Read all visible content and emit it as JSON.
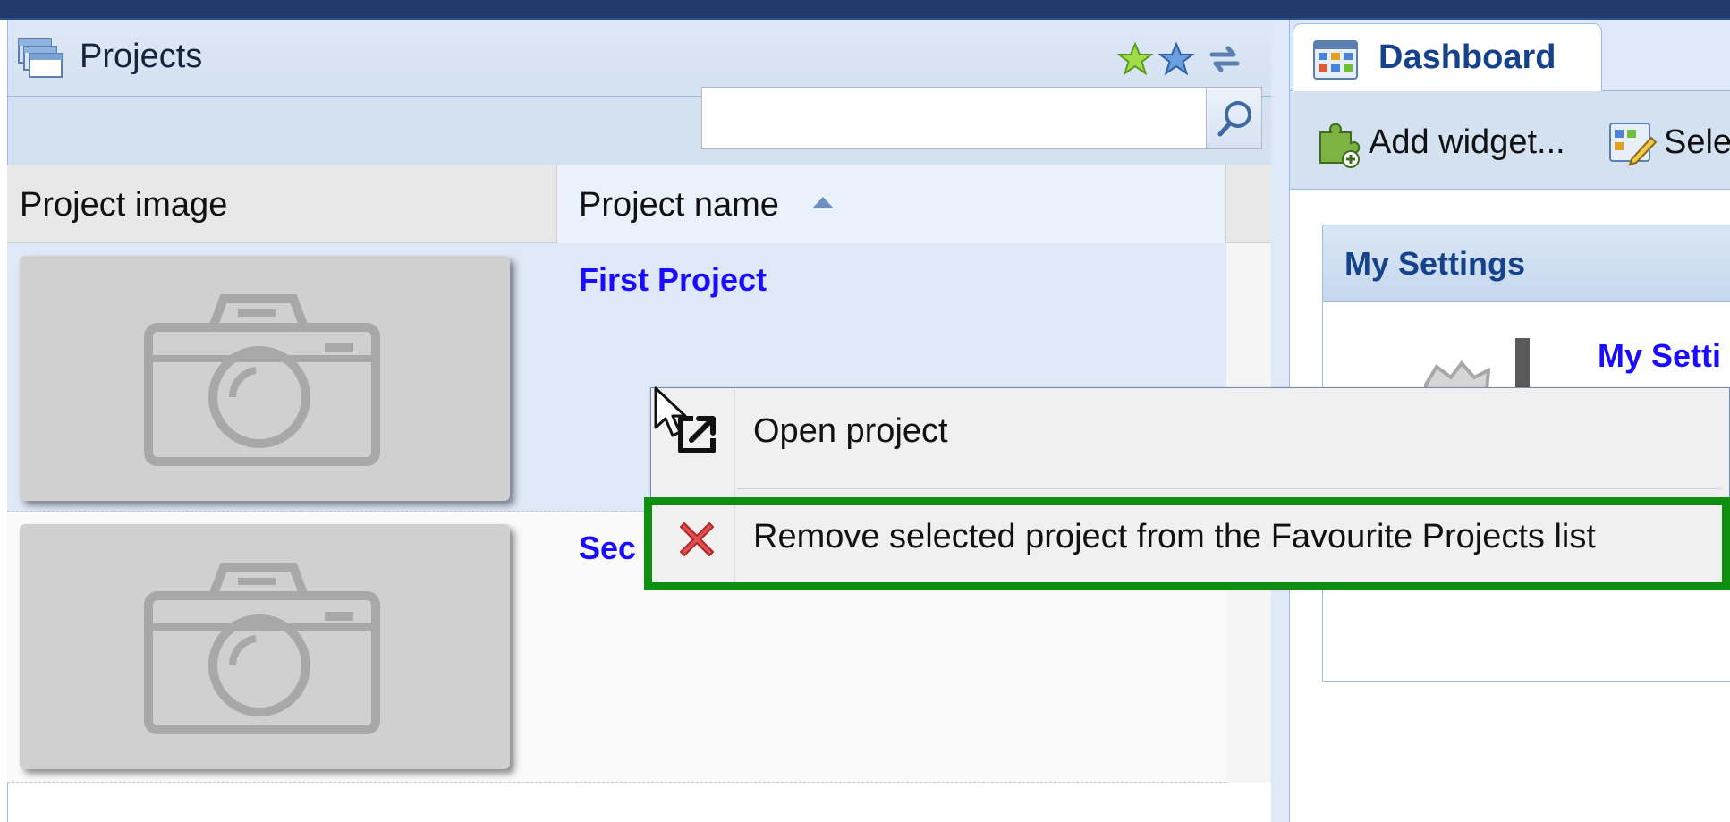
{
  "colors": {
    "topbar": "#1f3a6b",
    "panel_header": "#dfe8f6",
    "link_blue": "#1a0dff",
    "tab_title": "#15428b",
    "highlight_green": "#0f8f0f",
    "remove_red": "#e03a3a"
  },
  "projects_panel": {
    "title": "Projects",
    "title_icon": "projects-stack-icon",
    "tools": [
      {
        "name": "favourite-add-icon",
        "color": "#7fcf2a"
      },
      {
        "name": "favourite-star-icon",
        "color": "#4a84d6"
      },
      {
        "name": "refresh-icon",
        "color": "#5a7fb0"
      }
    ],
    "search": {
      "value": "",
      "placeholder": "",
      "button_icon": "search-icon"
    },
    "columns": {
      "image": "Project image",
      "name": "Project name",
      "sort": "ascending"
    },
    "rows": [
      {
        "name": "First Project",
        "image_icon": "camera-placeholder-icon",
        "selected": true
      },
      {
        "name": "Sec",
        "image_icon": "camera-placeholder-icon",
        "selected": false
      }
    ]
  },
  "dashboard": {
    "tab": {
      "label": "Dashboard",
      "icon": "dashboard-grid-icon"
    },
    "toolbar": {
      "add_widget": "Add widget...",
      "select": "Sele"
    },
    "portlet": {
      "title": "My Settings",
      "link": "My Setti",
      "icon": "settings-gear-icon"
    }
  },
  "context_menu": {
    "items": [
      {
        "label": "Open project",
        "icon": "open-external-icon"
      },
      {
        "label": "Remove selected project from the Favourite Projects list",
        "icon": "remove-x-icon",
        "highlighted": true
      }
    ]
  }
}
